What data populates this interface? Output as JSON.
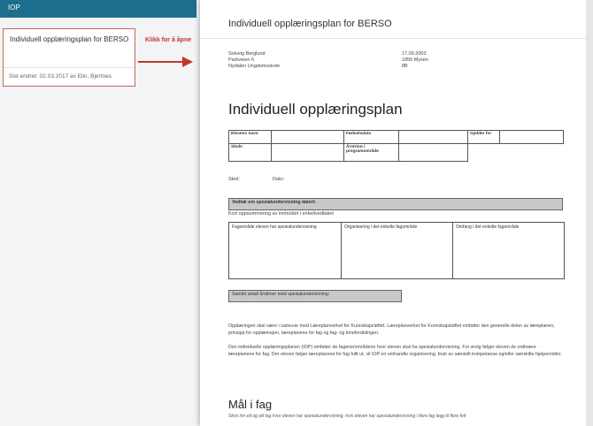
{
  "app": {
    "title": "IOP"
  },
  "document_card": {
    "title": "Individuell opplæringsplan for BERSO",
    "footer": "Sist endret: 02.03.2017 av Elin, Bjertnes"
  },
  "hint": {
    "text": "Klikk for å åpne"
  },
  "preview": {
    "title": "Individuell opplæringsplan for BERSO",
    "address_left": [
      "Solveig Berglund",
      "Parkveien 6",
      "Nydalen Ungdomsskole"
    ],
    "address_right": [
      "17.09.2003",
      "1850 Mysen",
      "8B"
    ],
    "heading": "Individuell opplæringsplan",
    "info_table": {
      "elevens_navn": "Elevens navn",
      "fodselsdato": "Fødselsdato",
      "gjelder_for": "Gjelder for",
      "skole": "Skole",
      "arstrinn": "Årstrinn / programområde"
    },
    "sted": "Sted:",
    "dato": "Dato:",
    "vedtak_title": "Vedtak om spesialundervisning datert:",
    "vedtak_sub": "Kort oppsummering av innholdet i enkeltvedtaket",
    "subject_cols": [
      "Fagområde eleven har spesialundervisning",
      "Organisering i det enkelte fagområde",
      "Omfang i det enkelte fagområde"
    ],
    "total_hours": "Samlet antall årstimer med spesialundervisning:",
    "para1": "Opplæringen skal være i samsvar med Læreplanverket for Kunnskapsløftet. Læreplanverket for Kunnskapsløftet omfatter den generelle delen av læreplanen, prinsipp for opplæringen, læreplanene for fag og fag- og timefordelingen.",
    "para2": "Den individuelle opplæringsplanen (IOP) omfatter de fagene/områdene hvor eleven skal ha spesialundervisning. For øvrig følger eleven de ordinære læreplanene for fag. Der eleven følger læreplanene for fag fullt ut, vil IOP en omhandle organisering, bruk av særskilt kompetanse og/eller særskilte hjelpemidler.",
    "section_title": "Mål i fag",
    "section_sub": "Skriv inn ett og ett fag hvor eleven har spesialundervisning, hvis eleven har spesialundervisning i flere fag legg til flere felt"
  },
  "colors": {
    "topbar": "#1c6e8c",
    "card_border": "#c06a5b",
    "hint": "#c0372a"
  }
}
